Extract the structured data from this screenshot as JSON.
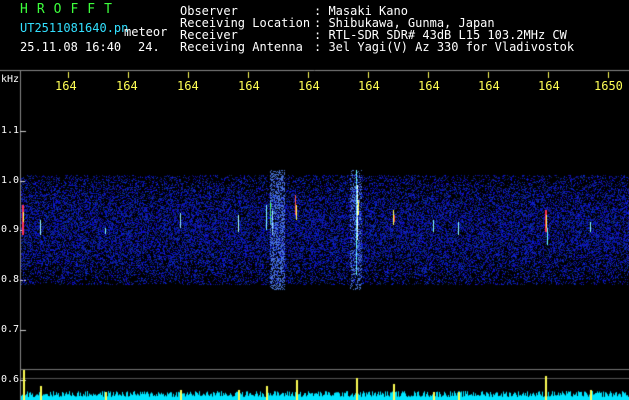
{
  "header": {
    "brand": "HROFFT",
    "filename": "UT2511081640.pn",
    "event": "meteor",
    "datetime": "25.11.08 16:40",
    "counter": "24."
  },
  "info": {
    "rows": [
      {
        "label": "Observer",
        "value": ": Masaki Kano"
      },
      {
        "label": "Receiving Location",
        "value": ": Shibukawa, Gunma, Japan"
      },
      {
        "label": "Receiver",
        "value": ": RTL-SDR SDR# 43dB L15 103.2MHz CW"
      },
      {
        "label": "Receiving Antenna",
        "value": ": 3el Yagi(V) Az 330 for Vladivostok"
      }
    ]
  },
  "axis": {
    "unit": "kHz",
    "top_ticks": [
      "164",
      "164",
      "164",
      "164",
      "164",
      "164",
      "164",
      "164",
      "164",
      "1650"
    ],
    "left_ticks": [
      "1.1",
      "1.0",
      "0.9",
      "0.8",
      "0.7",
      "0.6"
    ]
  },
  "colors": {
    "background": "#000000",
    "noise": "#1a2a9a",
    "baseline": "#00e5ff",
    "tick_label": "#ffff55"
  }
}
